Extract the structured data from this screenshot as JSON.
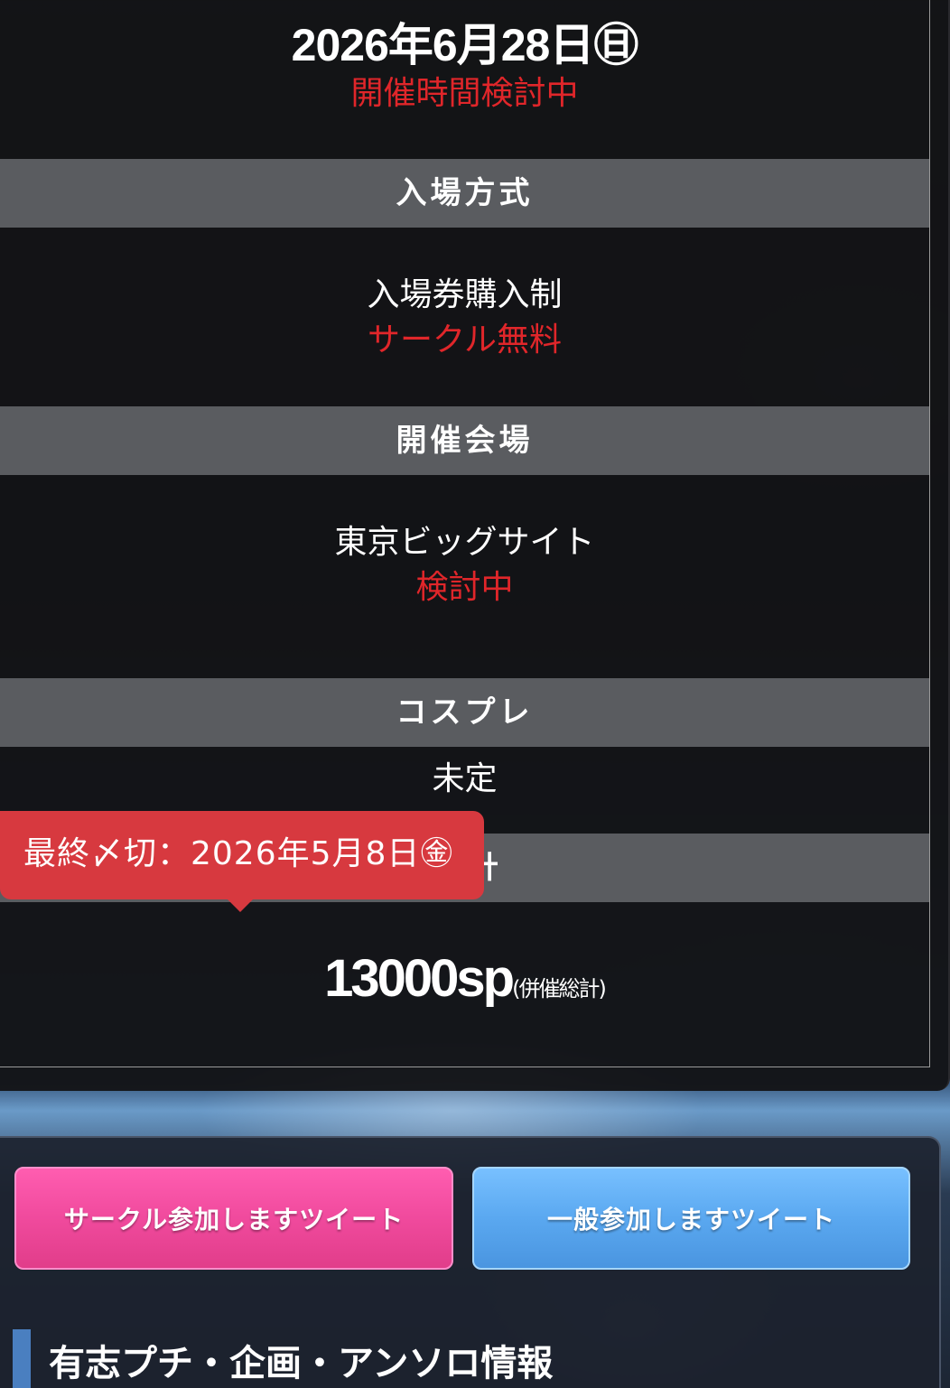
{
  "event": {
    "date": "2026年6月28日㊐",
    "time_note": "開催時間検討中"
  },
  "entry": {
    "heading": "入場方式",
    "method": "入場券購入制",
    "circle_note": "サークル無料"
  },
  "venue": {
    "heading": "開催会場",
    "name": "東京ビッグサイト",
    "note": "検討中"
  },
  "cosplay": {
    "heading": "コスプレ",
    "value": "未定"
  },
  "spaces": {
    "heading_visible": "計",
    "value": "13000sp",
    "note": "(併催総計)"
  },
  "deadline_tooltip": "最終〆切：2026年5月8日㊎",
  "buttons": {
    "circle_tweet": "サークル参加しますツイート",
    "general_tweet": "一般参加しますツイート"
  },
  "section_title": "有志プチ・企画・アンソロ情報",
  "colors": {
    "accent_red": "#e0262a",
    "tooltip_red": "#d7393f",
    "pink_button": "#f04a9d",
    "blue_button": "#5aa8f0",
    "section_head_gray": "#5a5c60"
  }
}
